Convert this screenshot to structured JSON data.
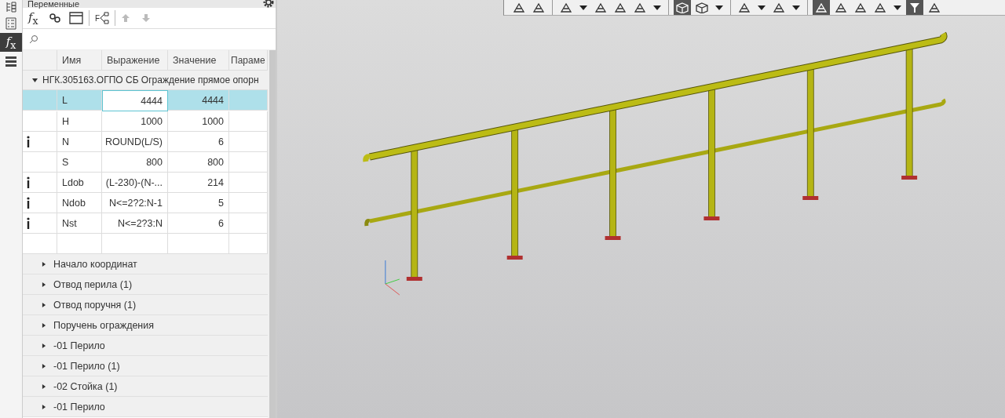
{
  "side_tabs": [
    {
      "kind": "tree",
      "selected": false
    },
    {
      "kind": "list",
      "selected": false
    },
    {
      "kind": "formula",
      "label": "*f*$_{x}$",
      "selected": true
    },
    {
      "kind": "menu",
      "selected": false
    }
  ],
  "panel": {
    "title": "Переменные",
    "toolbar": [
      {
        "kind": "formula",
        "label": "*f*$_{x}$",
        "disabled": false
      },
      {
        "kind": "link",
        "disabled": false
      },
      {
        "kind": "window",
        "disabled": false
      },
      {
        "kind": "sep"
      },
      {
        "kind": "tree",
        "label": "F",
        "disabled": false
      },
      {
        "kind": "sep"
      },
      {
        "kind": "up",
        "disabled": true
      },
      {
        "kind": "down",
        "disabled": true
      }
    ],
    "columns": [
      "Имя",
      "Выражение",
      "Значение",
      "Параме"
    ],
    "root": {
      "label": "НГК.305163.ОГПО СБ Ограждение прямое опорн",
      "expanded": true
    },
    "rows": [
      {
        "name": "L",
        "expression": "4444",
        "value": "4444",
        "info": false,
        "selected": true
      },
      {
        "name": "H",
        "expression": "1000",
        "value": "1000",
        "info": false,
        "selected": false
      },
      {
        "name": "N",
        "expression": "ROUND(L/S)",
        "value": "6",
        "info": true,
        "selected": false
      },
      {
        "name": "S",
        "expression": "800",
        "value": "800",
        "info": false,
        "selected": false
      },
      {
        "name": "Ldob",
        "expression": "(L-230)-(N-...",
        "value": "214",
        "info": true,
        "selected": false
      },
      {
        "name": "Ndob",
        "expression": "N<=2?2:N-1",
        "value": "5",
        "info": true,
        "selected": false
      },
      {
        "name": "Nst",
        "expression": "N<=2?3:N",
        "value": "6",
        "info": true,
        "selected": false
      }
    ],
    "groups": [
      {
        "label": "Начало координат",
        "expanded": false
      },
      {
        "label": "Отвод перила (1)",
        "expanded": false
      },
      {
        "label": "Отвод поручня (1)",
        "expanded": false
      },
      {
        "label": "Поручень ограждения",
        "expanded": false
      },
      {
        "label": "-01 Перило",
        "expanded": false
      },
      {
        "label": "-01 Перило (1)",
        "expanded": false
      },
      {
        "label": "-02 Стойка (1)",
        "expanded": false
      },
      {
        "label": "-01 Перило",
        "expanded": false
      }
    ]
  },
  "view_toolbar": [
    {
      "kind": "icon",
      "pressed": false
    },
    {
      "kind": "icon",
      "pressed": false
    },
    {
      "kind": "sep"
    },
    {
      "kind": "icon",
      "pressed": false
    },
    {
      "kind": "caret"
    },
    {
      "kind": "icon",
      "pressed": false
    },
    {
      "kind": "icon",
      "pressed": false
    },
    {
      "kind": "icon",
      "pressed": false
    },
    {
      "kind": "caret"
    },
    {
      "kind": "sep"
    },
    {
      "kind": "cube",
      "pressed": true
    },
    {
      "kind": "cube",
      "pressed": false
    },
    {
      "kind": "caret"
    },
    {
      "kind": "sep"
    },
    {
      "kind": "icon",
      "pressed": false
    },
    {
      "kind": "caret"
    },
    {
      "kind": "icon",
      "pressed": false
    },
    {
      "kind": "caret"
    },
    {
      "kind": "sep"
    },
    {
      "kind": "icon",
      "pressed": true
    },
    {
      "kind": "icon",
      "pressed": false
    },
    {
      "kind": "icon",
      "pressed": false
    },
    {
      "kind": "icon",
      "pressed": false
    },
    {
      "kind": "caret"
    },
    {
      "kind": "filter",
      "pressed": true
    },
    {
      "kind": "icon",
      "pressed": false
    }
  ]
}
